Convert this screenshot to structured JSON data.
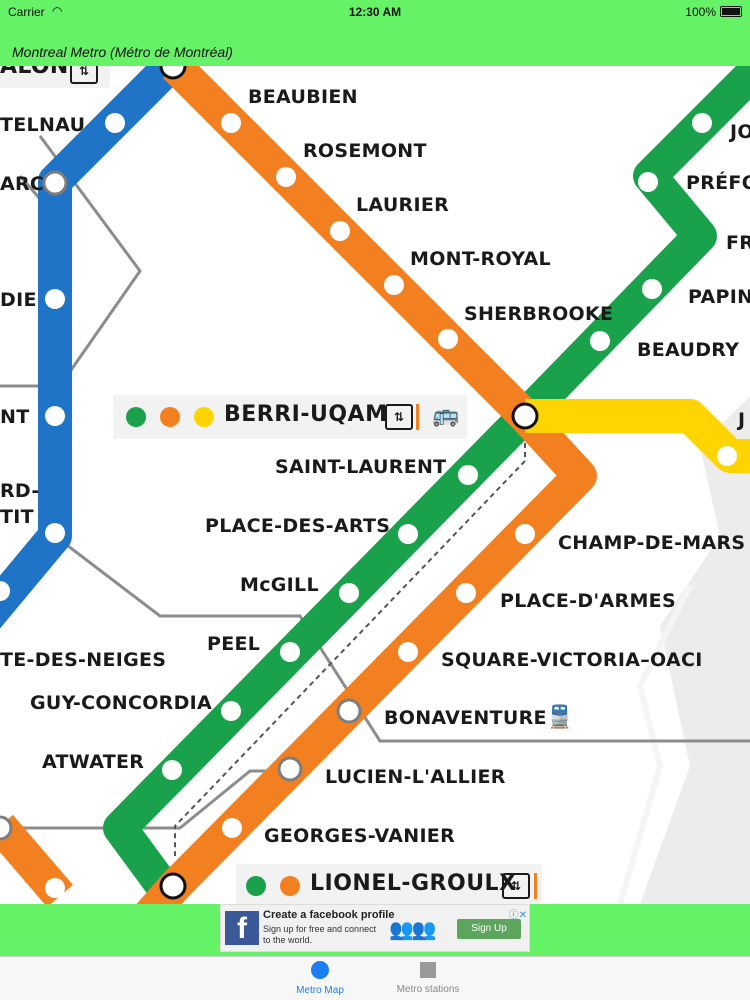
{
  "status_bar": {
    "carrier": "Carrier",
    "time": "12:30 AM",
    "battery": "100%"
  },
  "nav": {
    "title": "Montreal Metro (Métro de Montréal)"
  },
  "colors": {
    "green_line": "#1aa14b",
    "orange_line": "#f28020",
    "blue_line": "#1f74c7",
    "yellow_line": "#ffd400",
    "app_bar": "#66f266"
  },
  "stations": {
    "beaubien": "BEAUBIEN",
    "rosemont": "ROSEMONT",
    "laurier": "LAURIER",
    "mont_royal": "MONT-ROYAL",
    "sherbrooke": "SHERBROOKE",
    "saint_laurent": "SAINT-LAURENT",
    "place_des_arts": "PLACE-DES-ARTS",
    "mcgill": "McGILL",
    "peel": "PEEL",
    "guy_concordia": "GUY-CONCORDIA",
    "atwater": "ATWATER",
    "champ_de_mars": "CHAMP-DE-MARS",
    "place_d_armes": "PLACE-D'ARMES",
    "square_victoria": "SQUARE-VICTORIA–OACI",
    "bonaventure": "BONAVENTURE",
    "lucien_l_allier": "LUCIEN-L'ALLIER",
    "georges_vanier": "GEORGES-VANIER",
    "beaudry": "BEAUDRY",
    "papineau": "PAPIN",
    "frontenac": "FR",
    "prefontaine": "PRÉFO",
    "joliette": "JO",
    "jean_drapeau": "J",
    "cote_des_neiges": "TE-DES-NEIGES",
    "de_castelnau": "TELNAU",
    "parc": "ARC",
    "acadie": "DIE",
    "outremont": "NT",
    "edouard_montpetit_1": "RD-",
    "edouard_montpetit_2": "TIT",
    "jean_talon": "ALON"
  },
  "hubs": {
    "berri_uqam": "BERRI-UQAM",
    "lionel_groulx": "LIONEL-GROULX"
  },
  "icons": {
    "elevator": "elevator-icon",
    "bus": "bus-icon",
    "train": "train-icon",
    "elevator_glyph": "⇅"
  },
  "ad": {
    "title": "Create a facebook profile",
    "subtitle": "Sign up for free and connect to the world.",
    "button": "Sign Up",
    "logo": "f"
  },
  "tabs": [
    {
      "label": "Metro Map"
    },
    {
      "label": "Metro stations"
    }
  ]
}
